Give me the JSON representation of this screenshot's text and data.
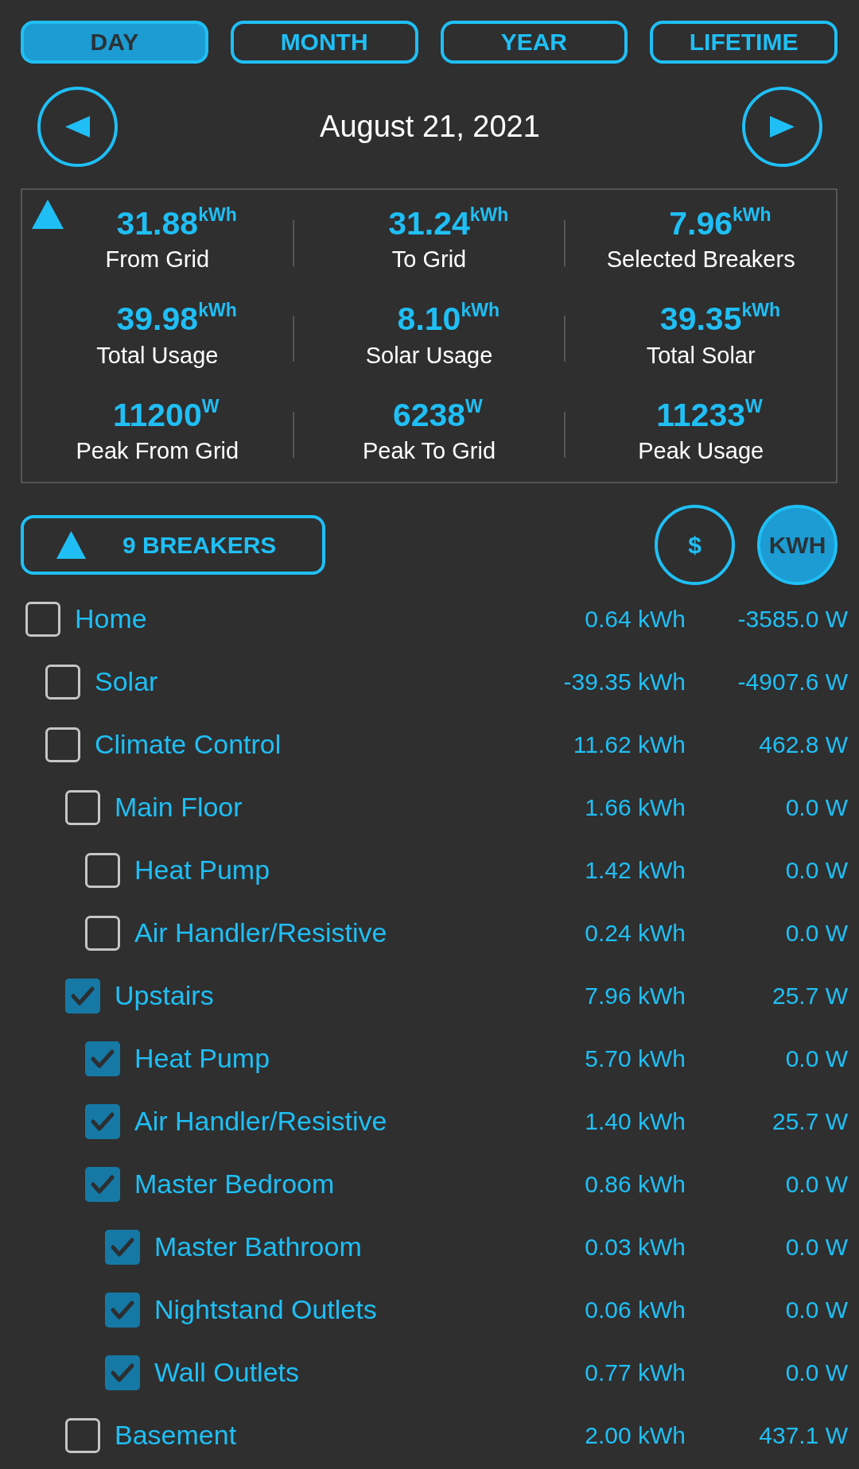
{
  "tabs": [
    {
      "label": "DAY",
      "selected": true
    },
    {
      "label": "MONTH",
      "selected": false
    },
    {
      "label": "YEAR",
      "selected": false
    },
    {
      "label": "LIFETIME",
      "selected": false
    }
  ],
  "date_nav": {
    "date": "August 21, 2021"
  },
  "summary": {
    "stats": [
      {
        "value": "31.88",
        "unit": "kWh",
        "label": "From Grid"
      },
      {
        "value": "31.24",
        "unit": "kWh",
        "label": "To Grid"
      },
      {
        "value": "7.96",
        "unit": "kWh",
        "label": "Selected Breakers"
      },
      {
        "value": "39.98",
        "unit": "kWh",
        "label": "Total Usage"
      },
      {
        "value": "8.10",
        "unit": "kWh",
        "label": "Solar Usage"
      },
      {
        "value": "39.35",
        "unit": "kWh",
        "label": "Total Solar"
      },
      {
        "value": "11200",
        "unit": "W",
        "label": "Peak From Grid"
      },
      {
        "value": "6238",
        "unit": "W",
        "label": "Peak To Grid"
      },
      {
        "value": "11233",
        "unit": "W",
        "label": "Peak Usage"
      }
    ]
  },
  "breakers_button": {
    "label": "9 BREAKERS"
  },
  "unit_toggle": [
    {
      "label": "$",
      "selected": false
    },
    {
      "label": "KWH",
      "selected": true
    }
  ],
  "tree": [
    {
      "name": "Home",
      "checked": false,
      "energy": "0.64 kWh",
      "power": "-3585.0 W",
      "children": [
        {
          "name": "Solar",
          "checked": false,
          "energy": "-39.35 kWh",
          "power": "-4907.6 W"
        },
        {
          "name": "Climate Control",
          "checked": false,
          "energy": "11.62 kWh",
          "power": "462.8 W",
          "children": [
            {
              "name": "Main Floor",
              "checked": false,
              "energy": "1.66 kWh",
              "power": "0.0 W",
              "children": [
                {
                  "name": "Heat Pump",
                  "checked": false,
                  "energy": "1.42 kWh",
                  "power": "0.0 W"
                },
                {
                  "name": "Air Handler/Resistive",
                  "checked": false,
                  "energy": "0.24 kWh",
                  "power": "0.0 W"
                }
              ]
            },
            {
              "name": "Upstairs",
              "checked": true,
              "energy": "7.96 kWh",
              "power": "25.7 W",
              "children": [
                {
                  "name": "Heat Pump",
                  "checked": true,
                  "energy": "5.70 kWh",
                  "power": "0.0 W"
                },
                {
                  "name": "Air Handler/Resistive",
                  "checked": true,
                  "energy": "1.40 kWh",
                  "power": "25.7 W"
                },
                {
                  "name": "Master Bedroom",
                  "checked": true,
                  "energy": "0.86 kWh",
                  "power": "0.0 W",
                  "children": [
                    {
                      "name": "Master Bathroom",
                      "checked": true,
                      "energy": "0.03 kWh",
                      "power": "0.0 W"
                    },
                    {
                      "name": "Nightstand Outlets",
                      "checked": true,
                      "energy": "0.06 kWh",
                      "power": "0.0 W"
                    },
                    {
                      "name": "Wall Outlets",
                      "checked": true,
                      "energy": "0.77 kWh",
                      "power": "0.0 W"
                    }
                  ]
                }
              ]
            },
            {
              "name": "Basement",
              "checked": false,
              "energy": "2.00 kWh",
              "power": "437.1 W"
            }
          ]
        }
      ]
    }
  ]
}
